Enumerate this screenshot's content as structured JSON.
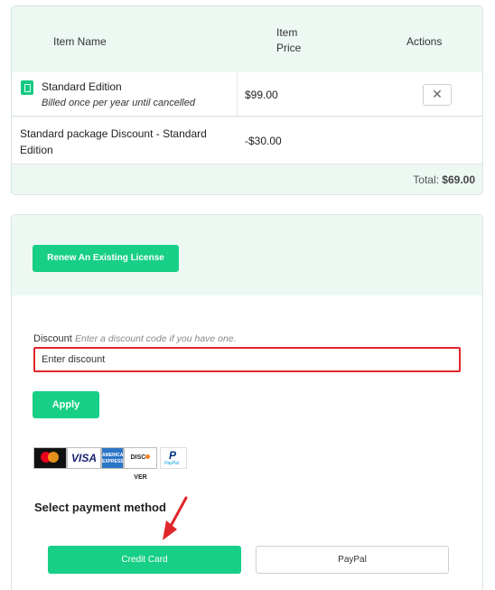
{
  "cart": {
    "headers": {
      "item_name": "Item Name",
      "item_price": "Item Price",
      "actions": "Actions"
    },
    "items": [
      {
        "name": "Standard Edition",
        "subtitle": "Billed once per year until cancelled",
        "price": "$99.00",
        "icon": "product-icon",
        "action_icon": "close-icon"
      },
      {
        "name": "Standard package Discount - Standard Edition",
        "price": "-$30.00"
      }
    ],
    "total_label": "Total:",
    "total_value": "$69.00"
  },
  "payment": {
    "renew_label": "Renew An Existing License",
    "discount_label": "Discount",
    "discount_hint": "Enter a discount code if you have one.",
    "discount_placeholder": "Enter discount",
    "apply_label": "Apply",
    "card_logos": [
      "mastercard-logo",
      "visa-logo",
      "amex-logo",
      "discover-logo",
      "paypal-logo"
    ],
    "method_title": "Select payment method",
    "credit_card_label": "Credit Card",
    "paypal_label": "PayPal"
  },
  "colors": {
    "accent": "#17cf86",
    "panel_bg": "#edf8f3",
    "highlight": "#e0262a"
  }
}
